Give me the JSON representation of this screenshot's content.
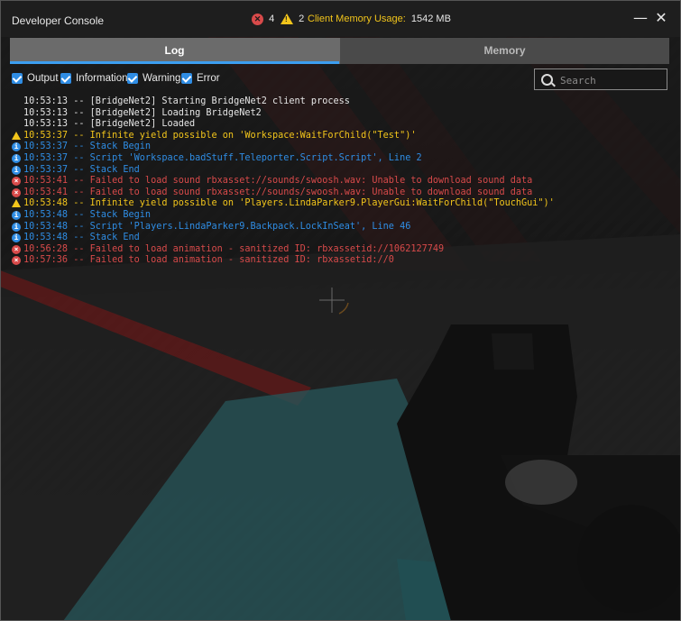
{
  "window": {
    "title": "Developer Console",
    "error_count": "4",
    "warning_count": "2",
    "memory_label": "Client Memory Usage:",
    "memory_value": "1542 MB",
    "minimize_glyph": "—",
    "close_glyph": "✕"
  },
  "tabs": [
    {
      "label": "Log",
      "active": true
    },
    {
      "label": "Memory",
      "active": false
    }
  ],
  "filters": [
    {
      "label": "Output",
      "checked": true
    },
    {
      "label": "Information",
      "checked": true
    },
    {
      "label": "Warning",
      "checked": true
    },
    {
      "label": "Error",
      "checked": true
    }
  ],
  "search": {
    "placeholder": "Search",
    "value": ""
  },
  "icons": {
    "error": "error-icon",
    "warning": "warning-icon",
    "info": "info-icon",
    "search": "search-icon",
    "checkbox": "checkbox-icon"
  },
  "colors": {
    "output": "#e6e6e6",
    "info": "#2f8de4",
    "warning": "#f2c51b",
    "error": "#d84a4a",
    "tab_accent": "#3c9ef0"
  },
  "log": [
    {
      "level": "output",
      "text": "10:53:13 -- [BridgeNet2] Starting BridgeNet2 client process"
    },
    {
      "level": "output",
      "text": "10:53:13 -- [BridgeNet2] Loading BridgeNet2"
    },
    {
      "level": "output",
      "text": "10:53:13 -- [BridgeNet2] Loaded"
    },
    {
      "level": "warning",
      "text": "10:53:37 -- Infinite yield possible on 'Workspace:WaitForChild(\"Test\")'"
    },
    {
      "level": "info",
      "text": "10:53:37 -- Stack Begin"
    },
    {
      "level": "info",
      "text": "10:53:37 -- Script 'Workspace.badStuff.Teleporter.Script.Script', Line 2"
    },
    {
      "level": "info",
      "text": "10:53:37 -- Stack End"
    },
    {
      "level": "error",
      "text": "10:53:41 -- Failed to load sound rbxasset://sounds/swoosh.wav: Unable to download sound data"
    },
    {
      "level": "error",
      "text": "10:53:41 -- Failed to load sound rbxasset://sounds/swoosh.wav: Unable to download sound data"
    },
    {
      "level": "warning",
      "text": "10:53:48 -- Infinite yield possible on 'Players.LindaParker9.PlayerGui:WaitForChild(\"TouchGui\")'"
    },
    {
      "level": "info",
      "text": "10:53:48 -- Stack Begin"
    },
    {
      "level": "info",
      "text": "10:53:48 -- Script 'Players.LindaParker9.Backpack.LockInSeat', Line 46"
    },
    {
      "level": "info",
      "text": "10:53:48 -- Stack End"
    },
    {
      "level": "error",
      "text": "10:56:28 -- Failed to load animation - sanitized ID: rbxassetid://1062127749"
    },
    {
      "level": "error",
      "text": "10:57:36 -- Failed to load animation - sanitized ID: rbxassetid://0"
    }
  ]
}
